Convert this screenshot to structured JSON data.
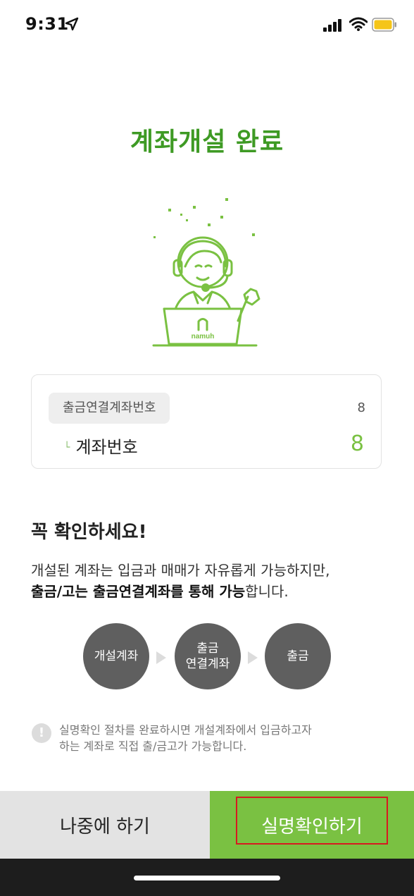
{
  "status_bar": {
    "time": "9:31",
    "icons": [
      "location-arrow-icon",
      "cellular-signal-icon",
      "wifi-icon",
      "battery-icon"
    ],
    "battery_color": "#f5c518"
  },
  "page": {
    "title": "계좌개설 완료",
    "illustration_brand": "namuh"
  },
  "account": {
    "link_label": "출금연결계좌번호",
    "link_value": "8",
    "account_label": "계좌번호",
    "account_value": "8"
  },
  "notice": {
    "title": "꼭 확인하세요!",
    "line1": "개설된 계좌는 입금과 매매가 자유롭게 가능하지만,",
    "line2_bold": "출금/고는 출금연결계좌를 통해 가능",
    "line2_rest": "합니다."
  },
  "flow": {
    "step1": "개설계좌",
    "step2_line1": "출금",
    "step2_line2": "연결계좌",
    "step3": "출금"
  },
  "info": {
    "icon": "!",
    "line1": "실명확인 절차를 완료하시면 개설계좌에서 입금하고자",
    "line2": "하는 계좌로 직접 출/금고가 가능합니다."
  },
  "buttons": {
    "later_label": "나중에 하기",
    "verify_label": "실명확인하기"
  },
  "colors": {
    "accent_green": "#7ac142",
    "title_green": "#3e9a24",
    "highlight_red": "#d71920"
  }
}
